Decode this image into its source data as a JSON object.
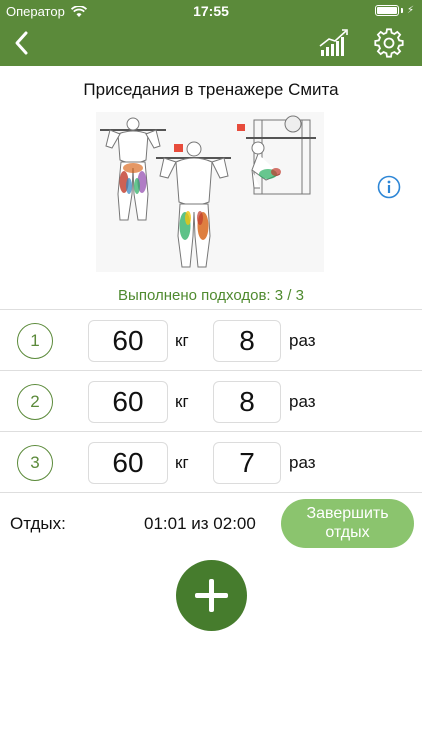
{
  "status_bar": {
    "carrier": "Оператор",
    "time": "17:55"
  },
  "screen": {
    "title": "Приседания в тренажере Смита",
    "sets_done": "Выполнено подходов: 3 / 3"
  },
  "sets": [
    {
      "number": "1",
      "weight": "60",
      "weight_unit": "кг",
      "reps": "8",
      "reps_unit": "раз"
    },
    {
      "number": "2",
      "weight": "60",
      "weight_unit": "кг",
      "reps": "8",
      "reps_unit": "раз"
    },
    {
      "number": "3",
      "weight": "60",
      "weight_unit": "кг",
      "reps": "7",
      "reps_unit": "раз"
    }
  ],
  "rest": {
    "label": "Отдых:",
    "time": "01:01 из 02:00",
    "finish_label": "Завершить\nотдых"
  },
  "icons": {
    "back": "chevron-left-icon",
    "chart": "chart-icon",
    "settings": "gear-icon",
    "info": "info-icon",
    "add": "plus-icon"
  },
  "colors": {
    "header": "#5b8a3a",
    "accent": "#4f8a2f",
    "finish_button": "#8bc46e",
    "add_button": "#467c2d",
    "info": "#2d86d6"
  }
}
